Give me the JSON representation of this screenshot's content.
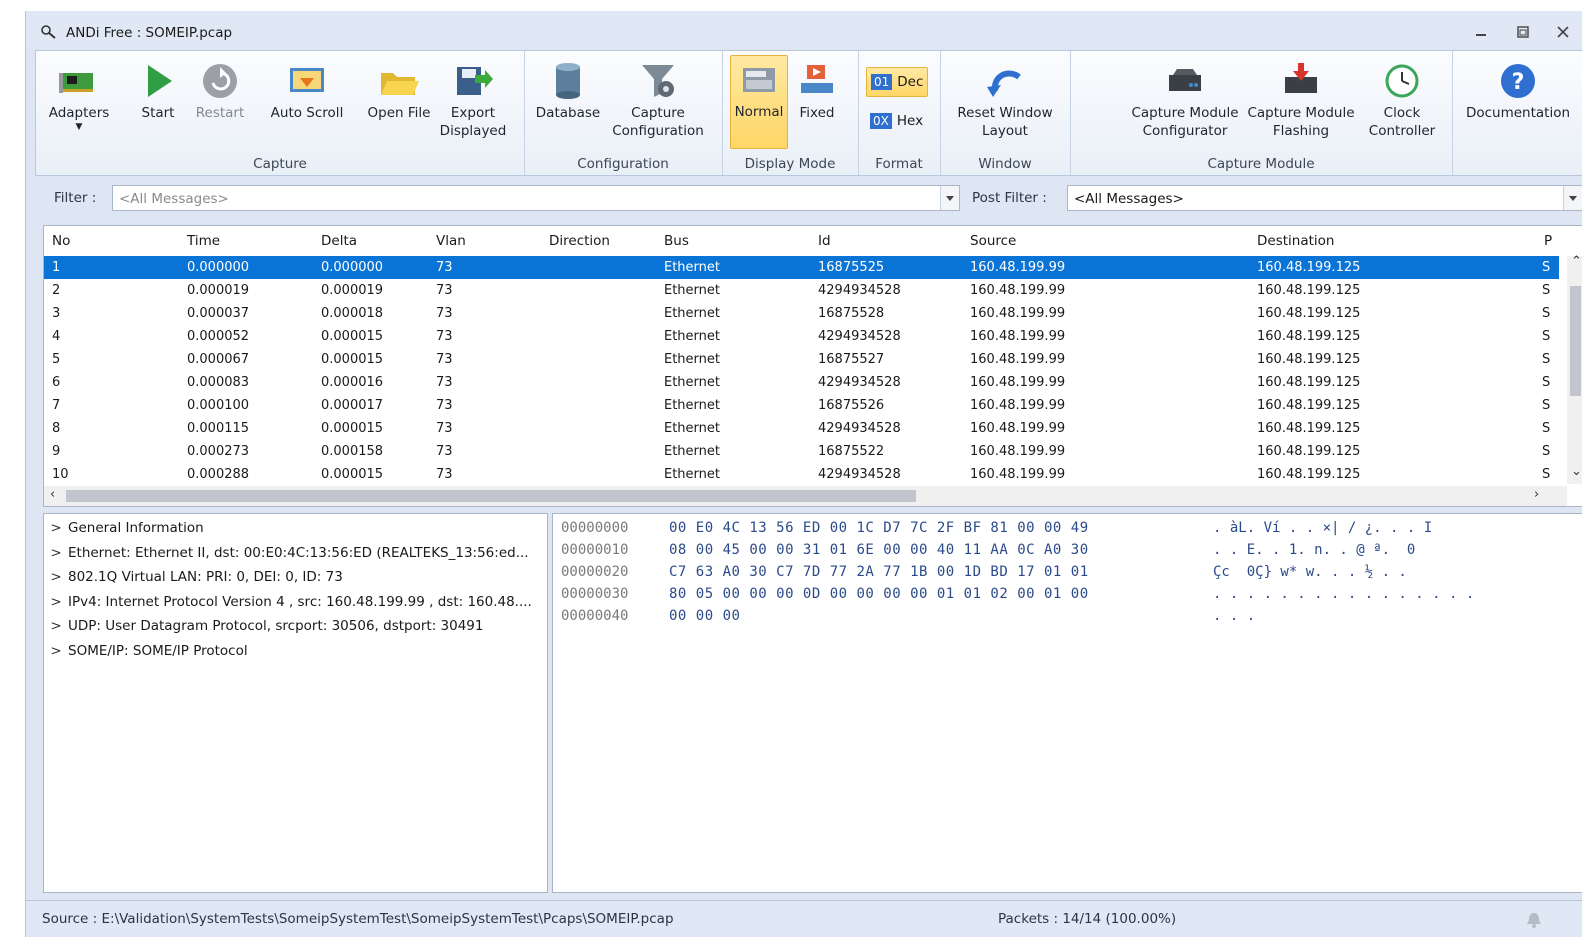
{
  "window": {
    "title": "ANDi Free : SOMEIP.pcap"
  },
  "ribbon": {
    "groups": [
      {
        "label": "Capture",
        "buttons": [
          "Adapters",
          "Start",
          "Restart",
          "Auto Scroll",
          "Open File",
          "Export\nDisplayed"
        ]
      },
      {
        "label": "Configuration",
        "buttons": [
          "Database",
          "Capture\nConfiguration"
        ]
      },
      {
        "label": "Display Mode",
        "buttons": [
          "Normal",
          "Fixed"
        ]
      },
      {
        "label": "Format",
        "buttons": [
          "Dec",
          "Hex"
        ],
        "chips": [
          "01",
          "0X"
        ]
      },
      {
        "label": "Window",
        "buttons": [
          "Reset Window\nLayout"
        ]
      },
      {
        "label": "Capture Module",
        "buttons": [
          "Capture Module\nConfigurator",
          "Capture Module\nFlashing",
          "Clock\nController"
        ]
      },
      {
        "label": "",
        "buttons": [
          "Documentation"
        ]
      }
    ]
  },
  "filter": {
    "label": "Filter :",
    "value": "<All Messages>",
    "post_label": "Post Filter :",
    "post_value": "<All Messages>"
  },
  "grid": {
    "columns": [
      "No",
      "Time",
      "Delta",
      "Vlan",
      "Direction",
      "Bus",
      "Id",
      "Source",
      "Destination",
      "P"
    ],
    "rows": [
      [
        "1",
        "0.000000",
        "0.000000",
        "73",
        "",
        "Ethernet",
        "16875525",
        "160.48.199.99",
        "160.48.199.125",
        "S"
      ],
      [
        "2",
        "0.000019",
        "0.000019",
        "73",
        "",
        "Ethernet",
        "4294934528",
        "160.48.199.99",
        "160.48.199.125",
        "S"
      ],
      [
        "3",
        "0.000037",
        "0.000018",
        "73",
        "",
        "Ethernet",
        "16875528",
        "160.48.199.99",
        "160.48.199.125",
        "S"
      ],
      [
        "4",
        "0.000052",
        "0.000015",
        "73",
        "",
        "Ethernet",
        "4294934528",
        "160.48.199.99",
        "160.48.199.125",
        "S"
      ],
      [
        "5",
        "0.000067",
        "0.000015",
        "73",
        "",
        "Ethernet",
        "16875527",
        "160.48.199.99",
        "160.48.199.125",
        "S"
      ],
      [
        "6",
        "0.000083",
        "0.000016",
        "73",
        "",
        "Ethernet",
        "4294934528",
        "160.48.199.99",
        "160.48.199.125",
        "S"
      ],
      [
        "7",
        "0.000100",
        "0.000017",
        "73",
        "",
        "Ethernet",
        "16875526",
        "160.48.199.99",
        "160.48.199.125",
        "S"
      ],
      [
        "8",
        "0.000115",
        "0.000015",
        "73",
        "",
        "Ethernet",
        "4294934528",
        "160.48.199.99",
        "160.48.199.125",
        "S"
      ],
      [
        "9",
        "0.000273",
        "0.000158",
        "73",
        "",
        "Ethernet",
        "16875522",
        "160.48.199.99",
        "160.48.199.125",
        "S"
      ],
      [
        "10",
        "0.000288",
        "0.000015",
        "73",
        "",
        "Ethernet",
        "4294934528",
        "160.48.199.99",
        "160.48.199.125",
        "S"
      ]
    ]
  },
  "tree": {
    "items": [
      "General Information",
      "Ethernet: Ethernet II, dst: 00:E0:4C:13:56:ED (REALTEKS_13:56:ed...",
      "802.1Q Virtual LAN: PRI: 0, DEI: 0, ID: 73",
      "IPv4: Internet Protocol Version 4 , src: 160.48.199.99 , dst: 160.48....",
      "UDP: User Datagram Protocol, srcport: 30506, dstport: 30491",
      "SOME/IP: SOME/IP Protocol"
    ]
  },
  "hex": {
    "lines": [
      {
        "offset": "00000000",
        "bytes": "00 E0 4C 13 56 ED 00 1C D7 7C 2F BF 81 00 00 49",
        "ascii": ". àL. Ví . . ×| / ¿. . . I"
      },
      {
        "offset": "00000010",
        "bytes": "08 00 45 00 00 31 01 6E 00 00 40 11 AA 0C A0 30",
        "ascii": ". . E. . 1. n. . @ ª.  0"
      },
      {
        "offset": "00000020",
        "bytes": "C7 63 A0 30 C7 7D 77 2A 77 1B 00 1D BD 17 01 01",
        "ascii": "Çc  0Ç} w* w. . . ½ . ."
      },
      {
        "offset": "00000030",
        "bytes": "80 05 00 00 00 0D 00 00 00 00 01 01 02 00 01 00",
        "ascii": ". . . . . . . . . . . . . . . ."
      },
      {
        "offset": "00000040",
        "bytes": "00 00 00",
        "ascii": ". . ."
      }
    ]
  },
  "status": {
    "source": "Source : E:\\Validation\\SystemTests\\SomeipSystemTest\\SomeipSystemTest\\Pcaps\\SOMEIP.pcap",
    "packets": "Packets : 14/14 (100.00%)"
  },
  "colors": {
    "selection": "#0a74d6",
    "accent": "#2f6fd0",
    "active": "#ffd667"
  }
}
